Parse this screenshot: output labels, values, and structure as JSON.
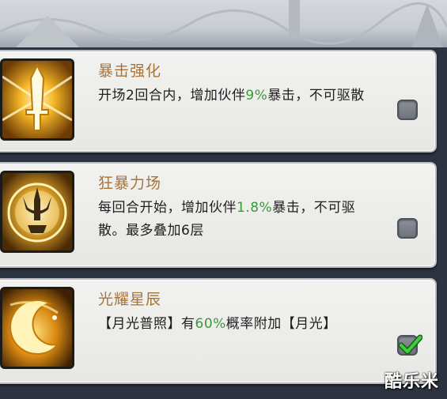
{
  "skills": [
    {
      "name": "暴击强化",
      "desc_pre": "开场2回合内，增加伙伴",
      "desc_hl": "9%",
      "desc_post": "暴击，不可驱散",
      "icon": "sword-burst-icon",
      "checked": false
    },
    {
      "name": "狂暴力场",
      "desc_pre": "每回合开始，增加伙伴",
      "desc_hl": "1.8%",
      "desc_post": "暴击，不可驱散。最多叠加6层",
      "icon": "trident-orb-icon",
      "checked": false
    },
    {
      "name": "光耀星辰",
      "desc_pre": "【月光普照】有",
      "desc_hl": "60%",
      "desc_post": "概率附加【月光】",
      "icon": "crescent-moon-icon",
      "checked": true
    }
  ],
  "colors": {
    "title": "#a8733a",
    "highlight": "#3a9a3a",
    "check": "#3fcf3f"
  },
  "watermark": "酷乐米"
}
